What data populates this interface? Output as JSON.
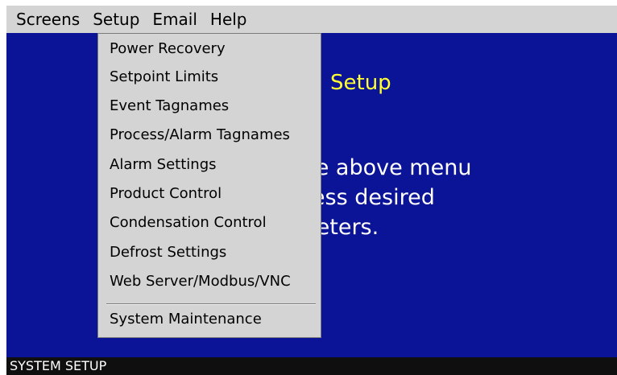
{
  "menubar": {
    "menus": [
      "Screens",
      "Setup",
      "Email",
      "Help"
    ]
  },
  "main": {
    "title": "Setup",
    "instructions_lines": [
      "Use the above menu",
      "to access desired",
      "parameters."
    ]
  },
  "setup_menu": {
    "items": [
      "Power Recovery",
      "Setpoint Limits",
      "Event Tagnames",
      "Process/Alarm Tagnames",
      "Alarm Settings",
      "Product Control",
      "Condensation Control",
      "Defrost Settings",
      "Web Server/Modbus/VNC"
    ],
    "after_separator": "System Maintenance"
  },
  "status": {
    "text": "SYSTEM SETUP"
  },
  "colors": {
    "background": "#0b1496",
    "title": "#ffff33",
    "menu_bg": "#d4d4d4",
    "status_bg": "#0f0f0f"
  }
}
